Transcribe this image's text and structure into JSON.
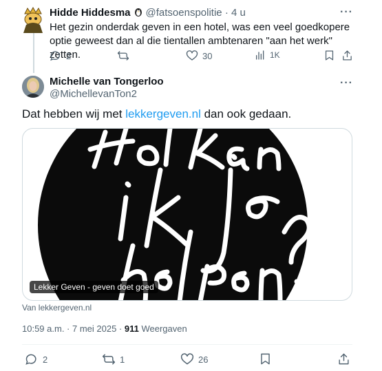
{
  "reply": {
    "name": "Hidde Hiddesma",
    "handle": "@fatsoenspolitie",
    "separator": "·",
    "time": "4 u",
    "text": "Het gezin onderdak geven in een hotel, was een veel goedkopere optie geweest dan al die tientallen ambtenaren \"aan het werk\" zetten.",
    "replies": "2",
    "reposts": "",
    "likes": "30",
    "views": "1K"
  },
  "tweet": {
    "name": "Michelle van Tongerloo",
    "handle": "@MichellevanTon2",
    "text_before": "Dat hebben wij met ",
    "link_text": "lekkergeven.nl",
    "text_after": " dan ook gedaan.",
    "card_label": "Lekker Geven - geven doet goed",
    "card_source": "Van lekkergeven.nl",
    "timestamp": "10:59 a.m. · 7 mei 2025 · ",
    "views_count": "911",
    "views_label": " Weergaven",
    "replies": "2",
    "reposts": "1",
    "likes": "26"
  },
  "more_label": "···",
  "colors": {
    "link": "#1d9bf0",
    "muted": "#536471",
    "text": "#0f1419"
  }
}
